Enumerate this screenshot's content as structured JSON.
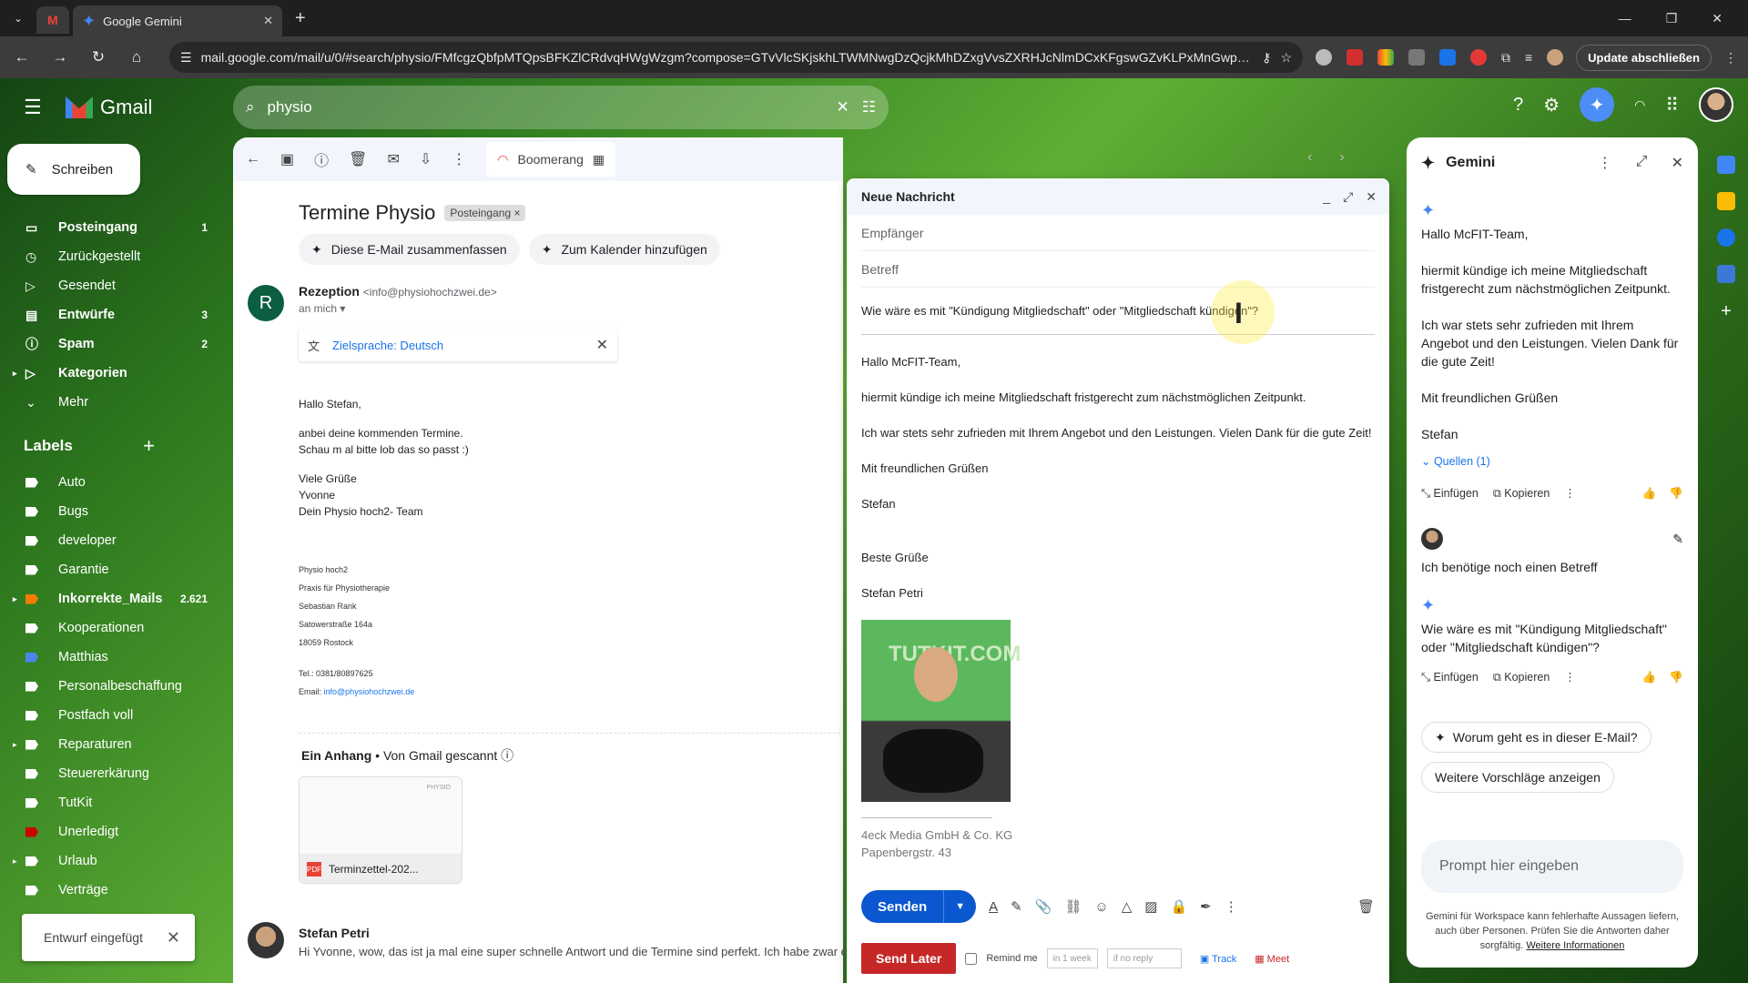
{
  "browser": {
    "tab_title": "Google Gemini",
    "url": "mail.google.com/mail/u/0/#search/physio/FMfcgzQbfpMTQpsBFKZlCRdvqHWgWzgm?compose=GTvVlcSKjskhLTWMNwgDzQcjkMhDZxgVvsZXRHJcNlmDCxKFgswGZvKLPxMnGwprlM...",
    "update_label": "Update abschließen"
  },
  "gmail": {
    "app_name": "Gmail",
    "search_value": "physio",
    "compose_label": "Schreiben",
    "nav": [
      {
        "label": "Posteingang",
        "count": "1",
        "bold": true
      },
      {
        "label": "Zurückgestellt",
        "count": ""
      },
      {
        "label": "Gesendet",
        "count": ""
      },
      {
        "label": "Entwürfe",
        "count": "3",
        "bold": true
      },
      {
        "label": "Spam",
        "count": "2",
        "bold": true
      },
      {
        "label": "Kategorien",
        "count": "",
        "bold": true
      },
      {
        "label": "Mehr",
        "count": ""
      }
    ],
    "labels_title": "Labels",
    "labels": [
      {
        "label": "Auto",
        "color": "#ffffff"
      },
      {
        "label": "Bugs",
        "color": "#ffffff"
      },
      {
        "label": "developer",
        "color": "#ffffff"
      },
      {
        "label": "Garantie",
        "color": "#ffffff"
      },
      {
        "label": "Inkorrekte_Mails",
        "color": "#f57c00",
        "count": "2.621"
      },
      {
        "label": "Kooperationen",
        "color": "#ffffff"
      },
      {
        "label": "Matthias",
        "color": "#4a86e8"
      },
      {
        "label": "Personalbeschaffung",
        "color": "#ffffff"
      },
      {
        "label": "Postfach voll",
        "color": "#ffffff"
      },
      {
        "label": "Reparaturen",
        "color": "#ffffff"
      },
      {
        "label": "Steuererkärung",
        "color": "#ffffff"
      },
      {
        "label": "TutKit",
        "color": "#ffffff"
      },
      {
        "label": "Unerledigt",
        "color": "#cc0000"
      },
      {
        "label": "Urlaub",
        "color": "#ffffff"
      },
      {
        "label": "Verträge",
        "color": "#ffffff"
      }
    ],
    "toast": "Entwurf eingefügt"
  },
  "mail": {
    "boomerang": "Boomerang",
    "subject": "Termine Physio",
    "tag": "Posteingang",
    "chip_summary": "Diese E-Mail zusammenfassen",
    "chip_calendar": "Zum Kalender hinzufügen",
    "sender_initial": "R",
    "sender_name": "Rezeption",
    "sender_addr": "<info@physiohochzwei.de>",
    "to": "an mich",
    "translate": "Zielsprache: Deutsch",
    "body": [
      "Hallo Stefan,",
      "anbei deine kommenden Termine.",
      "Schau m al bitte lob das so passt :)",
      "Viele Grüße",
      "Yvonne",
      "Dein Physio hoch2- Team"
    ],
    "sig": [
      "Physio hoch2",
      "Praxis für Physiotherapie",
      "Sebastian Rank",
      "Satowerstraße 164a",
      "18059 Rostock",
      "Tel.: 0381/80897625"
    ],
    "sig_email_label": "Email:",
    "sig_email": "info@physiohochzwei.de",
    "attach_title": "Ein Anhang",
    "attach_scan": "Von Gmail gescannt",
    "attach_name": "Terminzettel-202...",
    "attach_preview_text": "PHYSIO",
    "reply_name": "Stefan Petri",
    "reply_snippet": "Hi Yvonne, wow, das ist ja mal eine super schnelle Antwort und die Termine sind perfekt. Ich habe zwar e"
  },
  "compose": {
    "title": "Neue Nachricht",
    "to_placeholder": "Empfänger",
    "subject_placeholder": "Betreff",
    "inserted_line": "Wie wäre es mit \"Kündigung Mitgliedschaft\" oder \"Mitgliedschaft kündigen\"?",
    "paragraphs": [
      "Hallo McFIT-Team,",
      "hiermit kündige ich meine Mitgliedschaft fristgerecht zum nächstmöglichen Zeitpunkt.",
      "Ich war stets sehr zufrieden mit Ihrem Angebot und den Leistungen. Vielen Dank für die gute Zeit!",
      "Mit freundlichen Grüßen",
      "Stefan"
    ],
    "closing": [
      "Beste Grüße",
      "Stefan Petri"
    ],
    "photo_text": "TUTKIT.COM",
    "sig_sep": "------------------------------------------------",
    "company": [
      "4eck Media GmbH & Co. KG",
      "Papenbergstr. 43"
    ],
    "send": "Senden",
    "send_later": "Send Later",
    "remind": "Remind me",
    "in_week": "in 1 week",
    "no_reply": "if no reply",
    "track": "Track",
    "meet": "Meet"
  },
  "gemini": {
    "title": "Gemini",
    "answer": [
      "Hallo McFIT-Team,",
      "hiermit kündige ich meine Mitgliedschaft fristgerecht zum nächstmöglichen Zeitpunkt.",
      "Ich war stets sehr zufrieden mit Ihrem Angebot und den Leistungen. Vielen Dank für die gute Zeit!",
      "Mit freundlichen Grüßen",
      "Stefan"
    ],
    "sources": "Quellen (1)",
    "insert": "Einfügen",
    "copy": "Kopieren",
    "user_msg": "Ich benötige noch einen Betreff",
    "answer2": "Wie wäre es mit \"Kündigung Mitgliedschaft\" oder \"Mitgliedschaft kündigen\"?",
    "sugg1": "Worum geht es in dieser E-Mail?",
    "sugg2": "Weitere Vorschläge anzeigen",
    "prompt_placeholder": "Prompt hier eingeben",
    "footer": "Gemini für Workspace kann fehlerhafte Aussagen liefern, auch über Personen. Prüfen Sie die Antworten daher sorgfältig.",
    "footer_link": "Weitere Informationen"
  }
}
